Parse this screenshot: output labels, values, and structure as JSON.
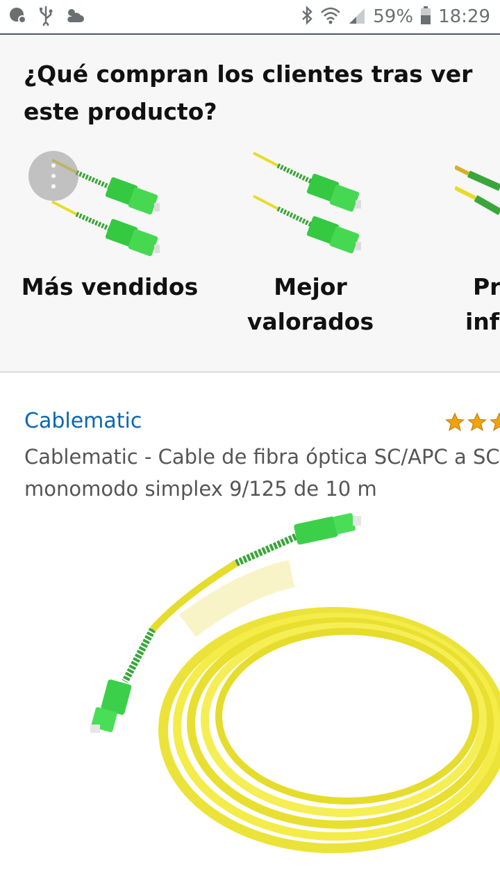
{
  "status_bar": {
    "battery_percent": "59%",
    "time": "18:29",
    "left_icons": [
      "notification-icon",
      "usb-icon",
      "weather-icon"
    ],
    "right_icons": [
      "bluetooth-icon",
      "wifi-icon",
      "signal-icon",
      "battery-icon"
    ]
  },
  "recommendations": {
    "title": "¿Qué compran los clientes tras ver este producto?",
    "items": [
      {
        "label_line1": "Más vendidos",
        "label_line2": ""
      },
      {
        "label_line1": "Mejor",
        "label_line2": "valorados"
      },
      {
        "label_line1": "Pr",
        "label_line2": "info"
      }
    ]
  },
  "product": {
    "brand": "Cablematic",
    "title_line1": "Cablematic - Cable de fibra óptica SC/APC a SC",
    "title_line2": "monomodo simplex 9/125 de 10 m",
    "rating_stars": 3
  },
  "colors": {
    "link": "#0a66b2",
    "section_bg": "#f7f7f7",
    "cable_yellow": "#f2ea3a",
    "connector_green": "#38d14a",
    "star": "#f4a20c"
  }
}
